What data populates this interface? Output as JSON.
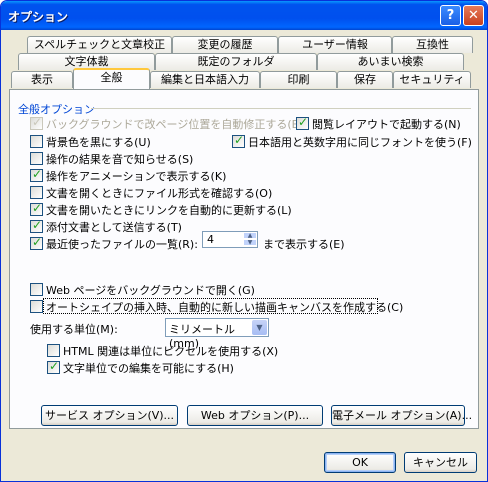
{
  "window": {
    "title": "オプション",
    "help_label": "?",
    "close_label": "✕"
  },
  "tabs_row1": [
    "スペルチェックと文章校正",
    "変更の履歴",
    "ユーザー情報",
    "互換性"
  ],
  "tabs_row2": [
    "文字体裁",
    "既定のフォルダ",
    "あいまい検索"
  ],
  "tabs_row3": [
    "表示",
    "全般",
    "編集と日本語入力",
    "印刷",
    "保存",
    "セキュリティ"
  ],
  "selected_tab": "全般",
  "group": {
    "label": "全般オプション"
  },
  "options": {
    "background_repaginate": {
      "label": "バックグラウンドで改ページ位置を自動修正する(B)",
      "checked": true,
      "disabled": true
    },
    "reading_layout": {
      "label": "閲覧レイアウトで起動する(N)",
      "checked": true
    },
    "blue_background": {
      "label": "背景色を黒にする(U)",
      "checked": false
    },
    "same_font": {
      "label": "日本語用と英数字用に同じフォントを使う(F)",
      "checked": true
    },
    "sound_feedback": {
      "label": "操作の結果を音で知らせる(S)",
      "checked": false
    },
    "animation_feedback": {
      "label": "操作をアニメーションで表示する(K)",
      "checked": true
    },
    "confirm_conversion": {
      "label": "文書を開くときにファイル形式を確認する(O)",
      "checked": false
    },
    "update_links": {
      "label": "文書を開いたときにリンクを自動的に更新する(L)",
      "checked": true
    },
    "send_attachment": {
      "label": "添付文書として送信する(T)",
      "checked": true
    },
    "recent_files": {
      "label": "最近使ったファイルの一覧(R):",
      "checked": true,
      "value": "4",
      "suffix": "まで表示する(E)"
    },
    "web_background": {
      "label": "Web ページをバックグラウンドで開く(G)",
      "checked": false
    },
    "drawing_canvas": {
      "label": "オートシェイプの挿入時、自動的に新しい描画キャンバスを作成する(C)",
      "checked": false
    }
  },
  "units": {
    "label": "使用する単位(M):",
    "value": "ミリメートル (mm)"
  },
  "html_pixels": {
    "label": "HTML 関連は単位にピクセルを使用する(X)",
    "checked": false
  },
  "char_width": {
    "label": "文字単位での編集を可能にする(H)",
    "checked": true
  },
  "buttons": {
    "service": "サービス オプション(V)...",
    "web": "Web オプション(P)...",
    "email": "電子メール オプション(A)...",
    "ok": "OK",
    "cancel": "キャンセル"
  }
}
